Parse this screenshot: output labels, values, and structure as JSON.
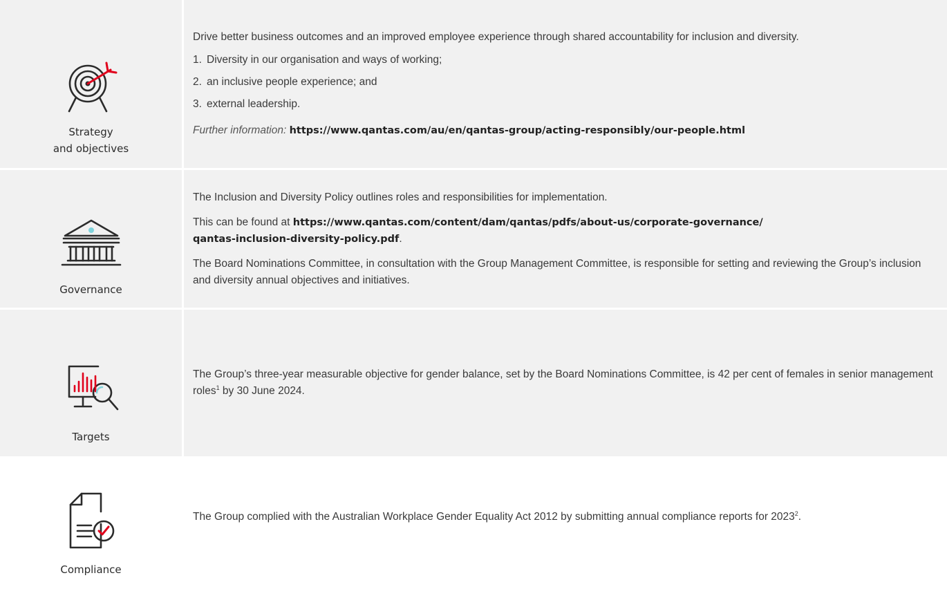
{
  "rows": {
    "strategy": {
      "label_line1": "Strategy",
      "label_line2": "and objectives",
      "intro": "Drive better business outcomes and an improved employee experience through shared accountability for inclusion and diversity.",
      "items": [
        {
          "num": "1.",
          "text": "Diversity in our organisation and ways of working;"
        },
        {
          "num": "2.",
          "text": "an inclusive people experience; and"
        },
        {
          "num": "3.",
          "text": "external leadership."
        }
      ],
      "further_label": "Further information:",
      "further_link": "https://www.qantas.com/au/en/qantas-group/acting-responsibly/our-people.html"
    },
    "governance": {
      "label": "Governance",
      "p1": "The Inclusion and Diversity Policy outlines roles and responsibilities for implementation.",
      "p2_prefix": "This can be found at ",
      "p2_link_line1": "https://www.qantas.com/content/dam/qantas/pdfs/about-us/corporate-governance/",
      "p2_link_line2": "qantas-inclusion-diversity-policy.pdf",
      "p2_suffix": ".",
      "p3": "The Board Nominations Committee, in consultation with the Group Management Committee, is responsible for setting and reviewing the Group’s inclusion and diversity annual objectives and initiatives."
    },
    "targets": {
      "label": "Targets",
      "text_a": "The Group’s three-year measurable objective for gender balance, set by the Board Nominations Committee, is 42 per cent of females in senior management roles",
      "sup": "1",
      "text_b": " by 30 June 2024."
    },
    "compliance": {
      "label": "Compliance",
      "text_a": "The Group complied with the Australian Workplace Gender Equality Act 2012 by submitting annual compliance reports for 2023",
      "sup": "2",
      "text_b": "."
    }
  },
  "colors": {
    "accent_red": "#e0001b",
    "accent_cyan": "#7fd3dc",
    "shade": "#f1f1f1",
    "text": "#3a3a3a"
  }
}
